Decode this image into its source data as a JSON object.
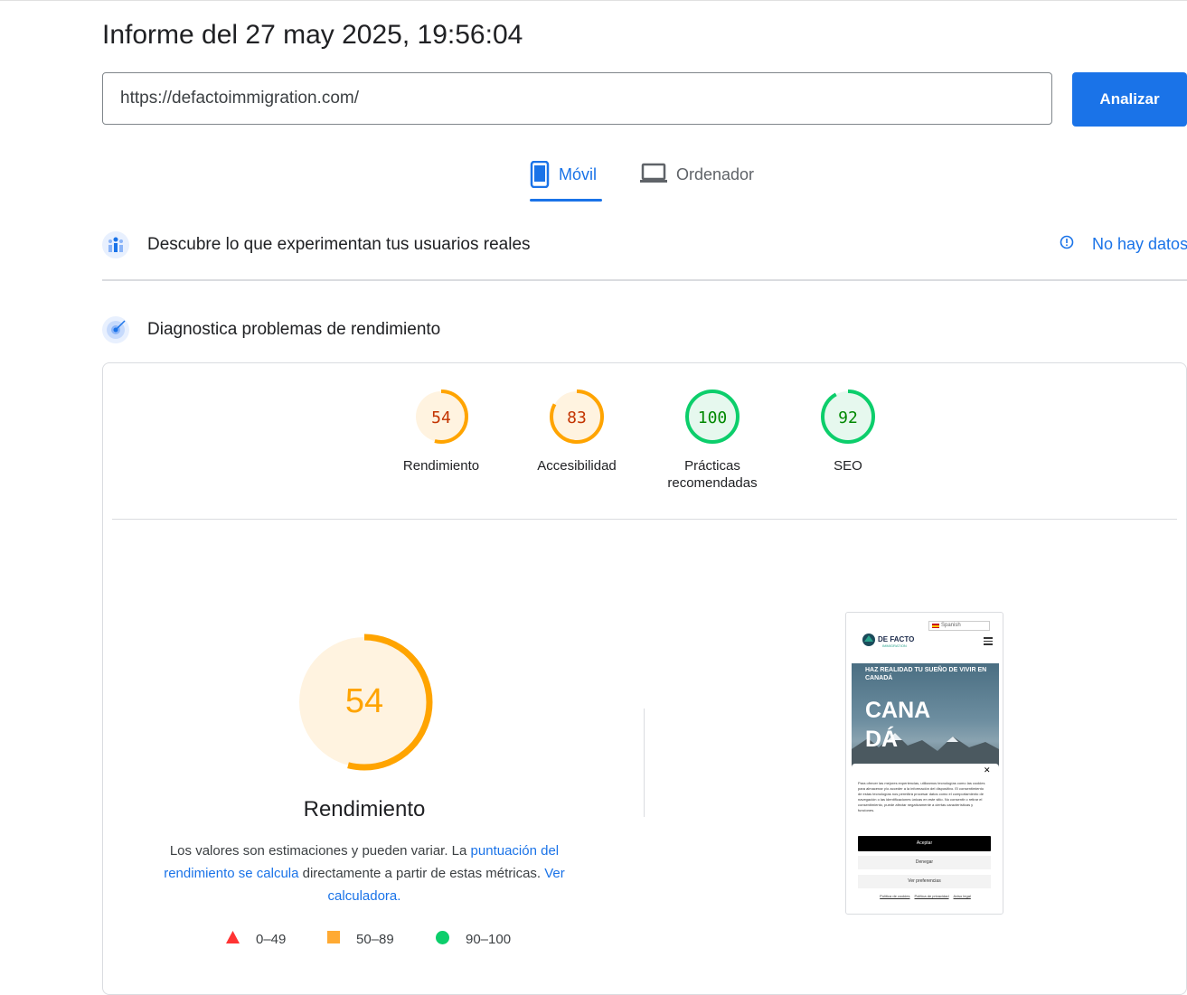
{
  "header": {
    "title": "Informe del 27 may 2025, 19:56:04"
  },
  "search": {
    "url_value": "https://defactoimmigration.com/",
    "analyze_label": "Analizar"
  },
  "tabs": [
    {
      "label": "Móvil",
      "icon": "phone-icon",
      "active": true
    },
    {
      "label": "Ordenador",
      "icon": "laptop-icon",
      "active": false
    }
  ],
  "field_data": {
    "title": "Descubre lo que experimentan tus usuarios reales",
    "icon": "users-chart-icon",
    "status_label": "No hay datos",
    "status_icon": "info-icon"
  },
  "lab_data": {
    "title": "Diagnostica problemas de rendimiento",
    "icon": "radar-icon"
  },
  "scores": [
    {
      "label_line1": "Rendimiento",
      "label_line2": "",
      "value": 54,
      "level": "average"
    },
    {
      "label_line1": "Accesibilidad",
      "label_line2": "",
      "value": 83,
      "level": "average"
    },
    {
      "label_line1": "Prácticas",
      "label_line2": "recomendadas",
      "value": 100,
      "level": "pass"
    },
    {
      "label_line1": "SEO",
      "label_line2": "",
      "value": 92,
      "level": "pass"
    }
  ],
  "performance": {
    "value": 54,
    "title": "Rendimiento",
    "desc_part1": "Los valores son estimaciones y pueden variar. La ",
    "desc_link1": "puntuación del rendimiento se calcula",
    "desc_part2": " directamente a partir de estas métricas. ",
    "desc_link2": "Ver calculadora."
  },
  "legend": [
    {
      "range": "0–49",
      "shape": "triangle",
      "color": "#ff3333"
    },
    {
      "range": "50–89",
      "shape": "square",
      "color": "#ffaa33"
    },
    {
      "range": "90–100",
      "shape": "circle",
      "color": "#0cce6b"
    }
  ],
  "colors": {
    "accent": "#1a73e8",
    "average": "#ffa400",
    "average_text": "#c33300",
    "average_bg": "#fff3e0",
    "pass": "#0cce6b",
    "pass_text": "#008800",
    "pass_bg": "#e6f8ee"
  },
  "screenshot": {
    "language": "Spanish",
    "logo": "DE FACTO",
    "logo_sub": "IMMIGRATION",
    "hero_subtitle": "HAZ REALIDAD TU SUEÑO DE VIVIR EN CANADÁ",
    "hero_line1": "CANA",
    "hero_line2": "DÁ",
    "cookie_text": "Para ofrecer las mejores experiencias, utilizamos tecnologías como las cookies para almacenar y/o acceder a la información del dispositivo. El consentimiento de estas tecnologías nos permitirá procesar datos como el comportamiento de navegación o las identificaciones únicas en este sitio. No consentir o retirar el consentimiento, puede afectar negativamente a ciertas características y funciones.",
    "accept_label": "Aceptar",
    "deny_label": "Denegar",
    "prefs_label": "Ver preferencias",
    "link1": "Política de cookies",
    "link2": "Política de privacidad",
    "link3": "Aviso legal"
  }
}
